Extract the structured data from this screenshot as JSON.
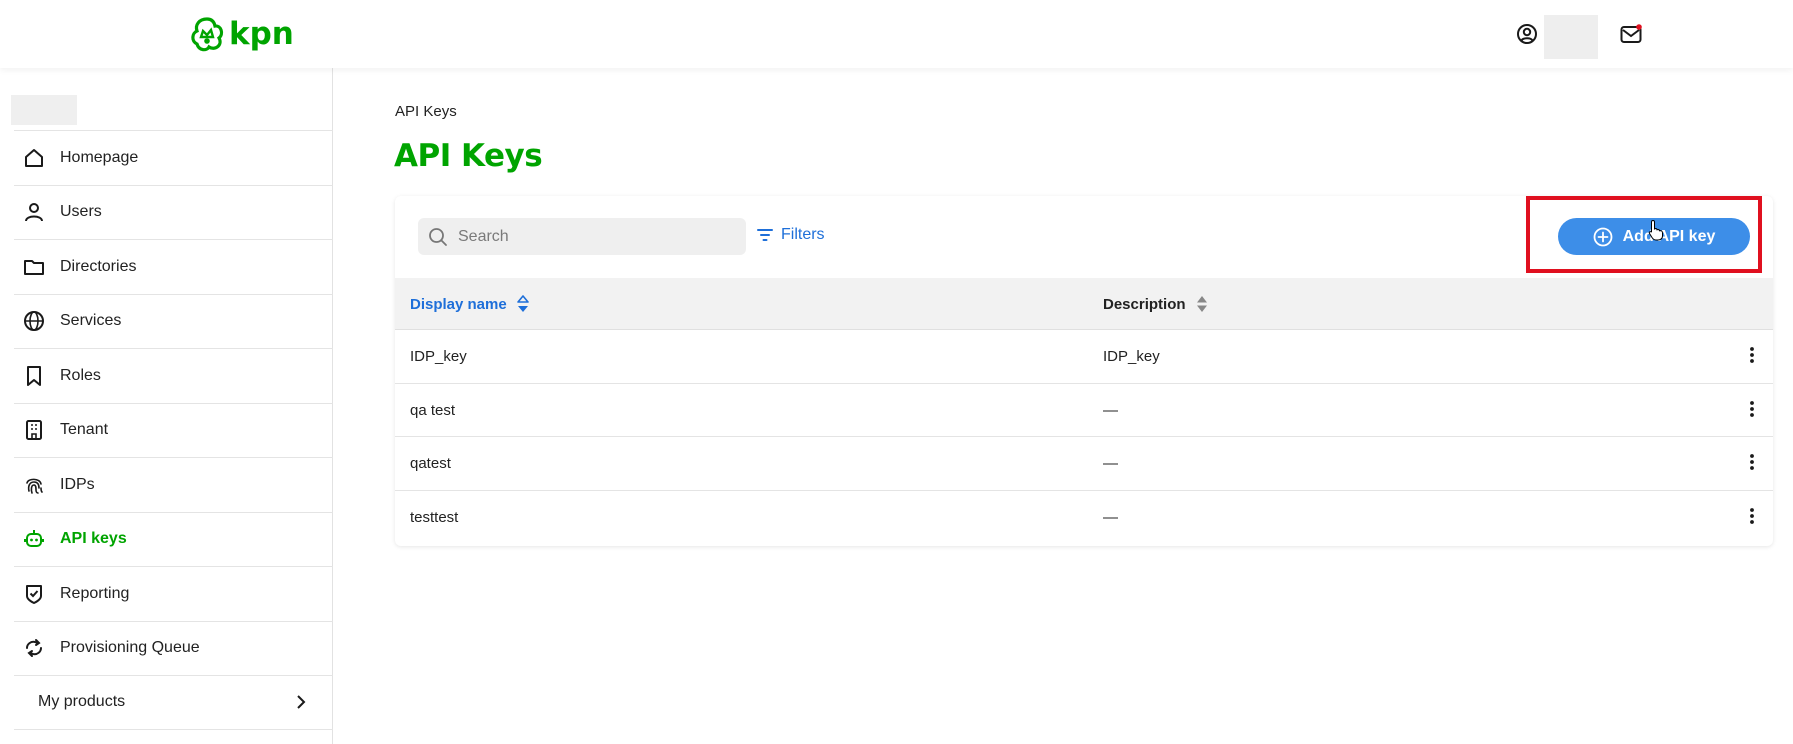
{
  "header": {
    "logo_text": "kpn",
    "brand_color": "#00a400",
    "user_icon": "user-circle-icon",
    "mail_icon": "mail-notification-icon"
  },
  "sidebar": {
    "items": [
      {
        "label": "Homepage",
        "icon": "home-icon"
      },
      {
        "label": "Users",
        "icon": "user-icon"
      },
      {
        "label": "Directories",
        "icon": "folder-icon"
      },
      {
        "label": "Services",
        "icon": "globe-icon"
      },
      {
        "label": "Roles",
        "icon": "bookmark-icon"
      },
      {
        "label": "Tenant",
        "icon": "building-icon"
      },
      {
        "label": "IDPs",
        "icon": "fingerprint-icon"
      },
      {
        "label": "API keys",
        "icon": "robot-icon",
        "active": true
      },
      {
        "label": "Reporting",
        "icon": "shield-check-icon"
      },
      {
        "label": "Provisioning Queue",
        "icon": "sync-icon"
      }
    ],
    "products_label": "My products"
  },
  "breadcrumb": "API Keys",
  "page_title": "API Keys",
  "toolbar": {
    "search_placeholder": "Search",
    "filters_label": "Filters",
    "add_button_label": "Add API key",
    "accent_color": "#3d8ee8"
  },
  "table": {
    "columns": [
      "Display name",
      "Description"
    ],
    "rows": [
      {
        "name": "IDP_key",
        "description": "IDP_key"
      },
      {
        "name": "qa test",
        "description": "—"
      },
      {
        "name": "qatest",
        "description": "—"
      },
      {
        "name": "testtest",
        "description": "—"
      }
    ]
  }
}
